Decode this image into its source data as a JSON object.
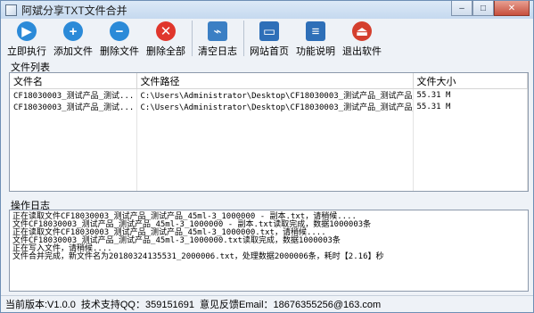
{
  "window": {
    "title": "阿斌分享TXT文件合并",
    "minimize_glyph": "–",
    "maximize_glyph": "□",
    "close_glyph": "✕"
  },
  "toolbar": {
    "buttons": [
      {
        "label": "立即执行",
        "icon": "play-icon",
        "glyph": "▶",
        "color": "#2b8ad8"
      },
      {
        "label": "添加文件",
        "icon": "plus-icon",
        "glyph": "+",
        "color": "#2b8ad8"
      },
      {
        "label": "删除文件",
        "icon": "minus-icon",
        "glyph": "−",
        "color": "#2b8ad8"
      },
      {
        "label": "删除全部",
        "icon": "close-circle-icon",
        "glyph": "✕",
        "color": "#e0362c"
      },
      {
        "label": "清空日志",
        "icon": "broom-icon",
        "glyph": "⌁",
        "color": "#3b7fc4"
      },
      {
        "label": "网站首页",
        "icon": "monitor-icon",
        "glyph": "▭",
        "color": "#2e6fb8"
      },
      {
        "label": "功能说明",
        "icon": "document-icon",
        "glyph": "≡",
        "color": "#2e6fb8"
      },
      {
        "label": "退出软件",
        "icon": "exit-icon",
        "glyph": "⏏",
        "color": "#d43f2e"
      }
    ]
  },
  "file_list": {
    "label": "文件列表",
    "columns": [
      "文件名",
      "文件路径",
      "文件大小"
    ],
    "rows": [
      [
        "CF18030003_测试产品_测试...",
        "C:\\Users\\Administrator\\Desktop\\CF18030003_测试产品_测试产品_4...",
        "55.31 M"
      ],
      [
        "CF18030003_测试产品_测试...",
        "C:\\Users\\Administrator\\Desktop\\CF18030003_测试产品_测试产品_4...",
        "55.31 M"
      ]
    ]
  },
  "log": {
    "label": "操作日志",
    "lines": [
      "正在读取文件CF18030003_测试产品_测试产品_45ml-3_1000000 - 副本.txt，请稍候....",
      "文件CF18030003_测试产品_测试产品_45ml-3_1000000 - 副本.txt读取完成，数据1000003条",
      "正在读取文件CF18030003_测试产品_测试产品_45ml-3_1000000.txt，请稍候....",
      "文件CF18030003_测试产品_测试产品_45ml-3_1000000.txt读取完成，数据1000003条",
      "正在写入文件，请稍候....",
      "文件合并完成，新文件名为20180324135531_2000006.txt，处理数据2000006条，耗时【2.16】秒"
    ]
  },
  "status": {
    "version": "当前版本:V1.0.0",
    "qq": "技术支持QQ：359151691",
    "email": "意见反馈Email：18676355256@163.com"
  }
}
